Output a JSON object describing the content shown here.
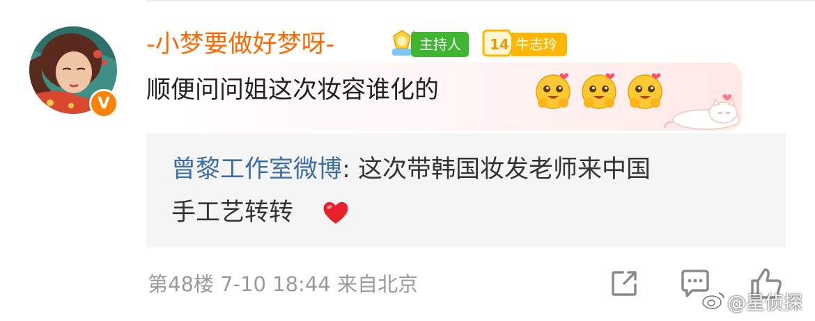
{
  "comment": {
    "username": "-小梦要做好梦呀-",
    "host_badge_label": "主持人",
    "fan_level": "14",
    "fan_label": "牛志玲",
    "verified_badge": "V",
    "text": "顺便问问姐这次妆容谁化的",
    "emoji_names": [
      "hug-emoji",
      "hug-emoji",
      "hug-emoji"
    ]
  },
  "reply": {
    "author": "曾黎工作室微博",
    "separator": ": ",
    "line1_text": "这次带韩国妆发老师来中国",
    "line2_text": "手工艺转转"
  },
  "footer": {
    "floor": "第48楼",
    "time": "7-10 18:44",
    "location": "来自北京"
  },
  "actions": [
    "share-icon",
    "comment-icon",
    "like-icon"
  ],
  "watermark": "@星侦探",
  "colors": {
    "username": "#ff6a00",
    "host_badge": "#3fb532",
    "fan_badge": "#ffb600",
    "reply_author": "#3a6ea5",
    "meta": "#9a9a9a"
  }
}
